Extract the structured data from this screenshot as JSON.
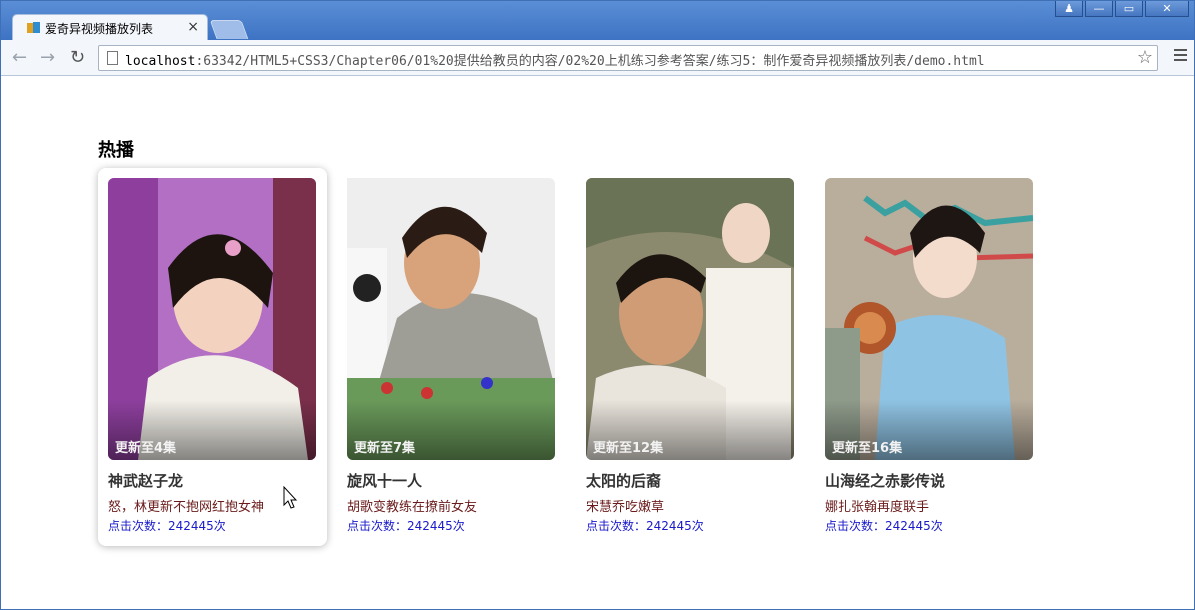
{
  "browser": {
    "tab_title": "爱奇异视频播放列表",
    "tab_close": "×",
    "url_host": "localhost",
    "url_rest": ":63342/HTML5+CSS3/Chapter06/01%20提供给教员的内容/02%20上机练习参考答案/练习5：制作爱奇异视频播放列表/demo.html",
    "window_buttons": {
      "user": "♟",
      "minimize": "—",
      "maximize": "▭",
      "close": "✕"
    }
  },
  "page": {
    "section_title": "热播",
    "cards": [
      {
        "update": "更新至4集",
        "title": "神武赵子龙",
        "desc": "怒，林更新不抱网红抱女神",
        "clicks": "点击次数：242445次"
      },
      {
        "update": "更新至7集",
        "title": "旋风十一人",
        "desc": "胡歌变教练在撩前女友",
        "clicks": "点击次数：242445次"
      },
      {
        "update": "更新至12集",
        "title": "太阳的后裔",
        "desc": "宋慧乔吃嫩草",
        "clicks": "点击次数：242445次"
      },
      {
        "update": "更新至16集",
        "title": "山海经之赤影传说",
        "desc": "娜扎张翰再度联手",
        "clicks": "点击次数：242445次"
      }
    ]
  },
  "colors": {
    "titlebar": "#4a7fcf",
    "desc_text": "#6b1b1b",
    "clicks_text": "#1a1acc"
  }
}
